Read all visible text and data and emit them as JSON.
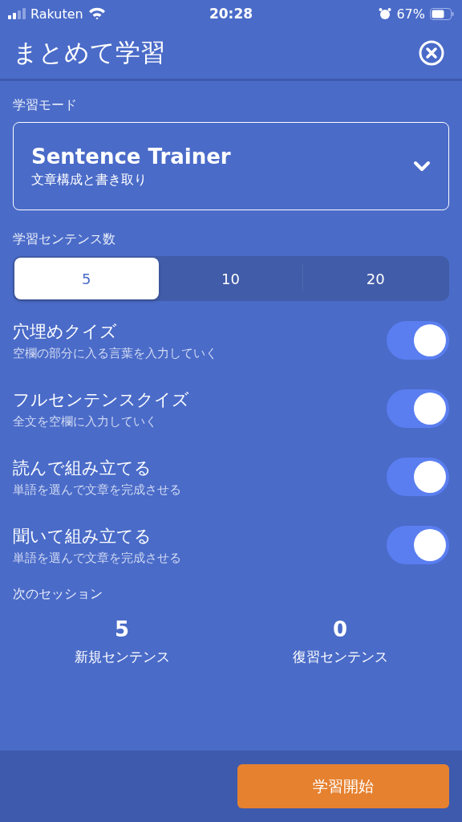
{
  "status_bar": {
    "carrier": "Rakuten",
    "time": "20:28",
    "battery": "67%"
  },
  "header": {
    "title": "まとめて学習"
  },
  "mode": {
    "label": "学習モード",
    "title": "Sentence Trainer",
    "subtitle": "文章構成と書き取り"
  },
  "count": {
    "label": "学習センテンス数",
    "options": [
      {
        "label": "5",
        "selected": true
      },
      {
        "label": "10",
        "selected": false
      },
      {
        "label": "20",
        "selected": false
      }
    ]
  },
  "quizzes": [
    {
      "title": "穴埋めクイズ",
      "subtitle": "空欄の部分に入る言葉を入力していく",
      "on": true
    },
    {
      "title": "フルセンテンスクイズ",
      "subtitle": "全文を空欄に入力していく",
      "on": true
    },
    {
      "title": "読んで組み立てる",
      "subtitle": "単語を選んで文章を完成させる",
      "on": true
    },
    {
      "title": "聞いて組み立てる",
      "subtitle": "単語を選んで文章を完成させる",
      "on": true
    }
  ],
  "next_session": {
    "label": "次のセッション",
    "stats": [
      {
        "value": "5",
        "label": "新規センテンス"
      },
      {
        "value": "0",
        "label": "復習センテンス"
      }
    ]
  },
  "start_button": "学習開始"
}
